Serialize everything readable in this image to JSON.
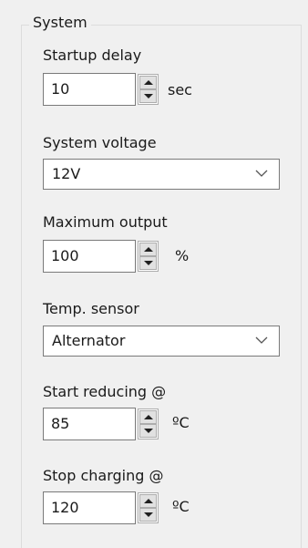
{
  "system_group": {
    "title": "System",
    "startup_delay": {
      "label": "Startup delay",
      "value": "10",
      "unit": "sec"
    },
    "system_voltage": {
      "label": "System voltage",
      "selected": "12V"
    },
    "maximum_output": {
      "label": "Maximum output",
      "value": "100",
      "unit": "%"
    },
    "temp_sensor": {
      "label": "Temp. sensor",
      "selected": "Alternator"
    },
    "start_reducing": {
      "label": "Start reducing @",
      "value": "85",
      "unit": "ºC"
    },
    "stop_charging": {
      "label": "Stop charging @",
      "value": "120",
      "unit": "ºC"
    }
  },
  "colors": {
    "panel_bg": "#f0f0f0",
    "input_border": "#7a7a7a",
    "spinner_face": "#e1e1e1"
  }
}
